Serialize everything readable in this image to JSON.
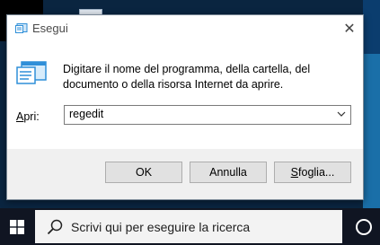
{
  "dialog": {
    "title": "Esegui",
    "close_symbol": "✕",
    "description": "Digitare il nome del programma, della cartella, del documento o della risorsa Internet da aprire.",
    "open_label_underlined": "A",
    "open_label_rest": "pri:",
    "open_value": "regedit",
    "ok_label": "OK",
    "cancel_label": "Annulla",
    "browse_label_underlined": "S",
    "browse_label_rest": "foglia..."
  },
  "taskbar": {
    "search_placeholder": "Scrivi qui per eseguire la ricerca"
  },
  "icons": {
    "run": "run-icon",
    "windows": "windows-logo-icon",
    "search": "search-icon",
    "cortana": "cortana-icon"
  },
  "colors": {
    "accent_blue": "#2f8fd8",
    "taskbar": "#101522",
    "search_bg": "#f3f3f3"
  }
}
